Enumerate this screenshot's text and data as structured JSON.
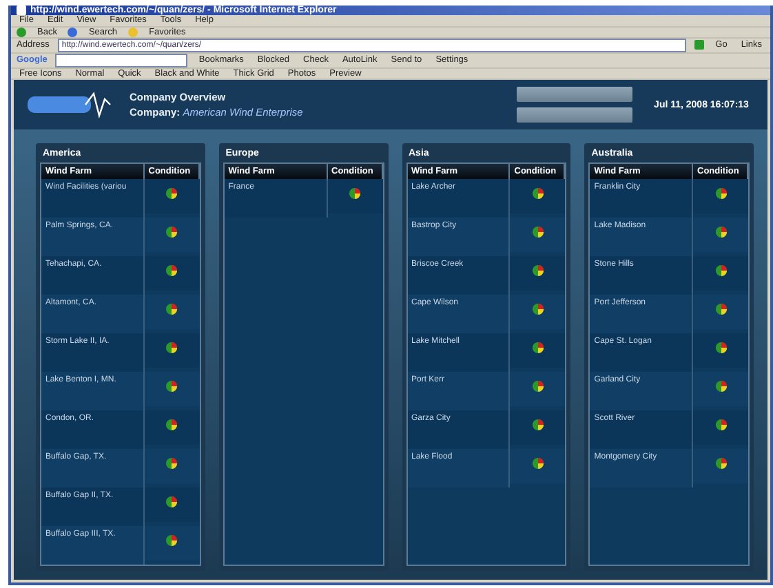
{
  "window": {
    "title": "http://wind.ewertech.com/~/quan/zers/ - Microsoft Internet Explorer"
  },
  "menu": [
    "File",
    "Edit",
    "View",
    "Favorites",
    "Tools",
    "Help"
  ],
  "toolbar": [
    "Back",
    "Search",
    "Favorites"
  ],
  "address": {
    "label": "Address",
    "value": "http://wind.ewertech.com/~/quan/zers/",
    "go": "Go",
    "links": "Links"
  },
  "google_bar": {
    "brand": "Google",
    "items": [
      "Bookmarks",
      "Blocked",
      "Check",
      "AutoLink",
      "Send to",
      "Settings"
    ]
  },
  "links_bar": [
    "Free Icons",
    "Normal",
    "Quick",
    "Black and White",
    "Thick Grid",
    "Photos",
    "Preview"
  ],
  "app": {
    "title": "Company Overview",
    "company_label": "Company:",
    "company_name": "American Wind Enterprise",
    "datetime": "Jul 11, 2008 16:07:13"
  },
  "regions": [
    {
      "name": "America",
      "columns": [
        "Wind Farm",
        "Condition"
      ],
      "rows": [
        "Wind Facilities (variou",
        "Palm Springs, CA.",
        "Tehachapi, CA.",
        "Altamont, CA.",
        "Storm Lake II, IA.",
        "Lake Benton I, MN.",
        "Condon, OR.",
        "Buffalo Gap, TX.",
        "Buffalo Gap II, TX.",
        "Buffalo Gap III, TX."
      ]
    },
    {
      "name": "Europe",
      "columns": [
        "Wind Farm",
        "Condition"
      ],
      "rows": [
        "France"
      ]
    },
    {
      "name": "Asia",
      "columns": [
        "Wind Farm",
        "Condition"
      ],
      "rows": [
        "Lake Archer",
        "Bastrop City",
        "Briscoe Creek",
        "Cape Wilson",
        "Lake Mitchell",
        "Port Kerr",
        "Garza City",
        "Lake Flood"
      ]
    },
    {
      "name": "Australia",
      "columns": [
        "Wind Farm",
        "Condition"
      ],
      "rows": [
        "Franklin City",
        "Lake Madison",
        "Stone Hills",
        "Port Jefferson",
        "Cape St. Logan",
        "Garland City",
        "Scott River",
        "Montgomery City"
      ]
    }
  ]
}
